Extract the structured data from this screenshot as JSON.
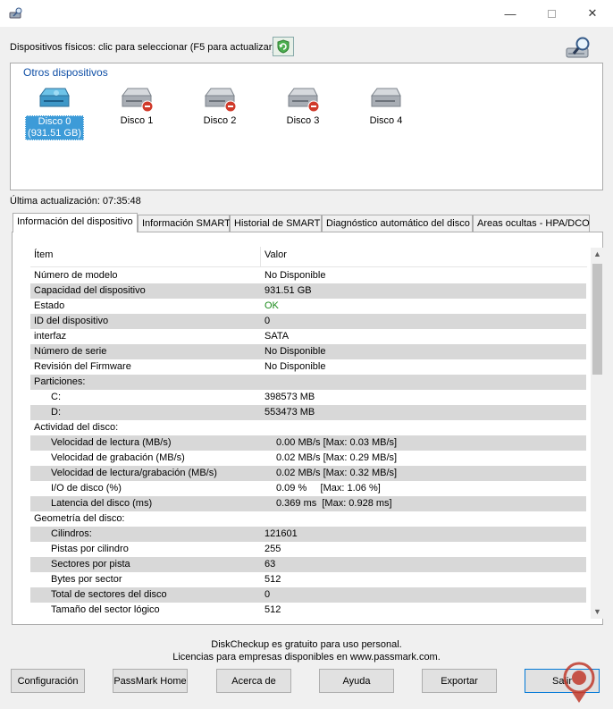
{
  "window": {
    "minimize_glyph": "—",
    "close_glyph": "✕"
  },
  "toolbar": {
    "devices_label": "Dispositivos físicos: clic para seleccionar (F5 para actualizar)"
  },
  "device_group": {
    "title": "Otros dispositivos",
    "disks": [
      {
        "name": "Disco 0",
        "size": "(931.51 GB)",
        "selected": true
      },
      {
        "name": "Disco 1",
        "size": "",
        "selected": false
      },
      {
        "name": "Disco 2",
        "size": "",
        "selected": false
      },
      {
        "name": "Disco 3",
        "size": "",
        "selected": false
      },
      {
        "name": "Disco 4",
        "size": "",
        "selected": false
      }
    ]
  },
  "last_update": "Última actualización: 07:35:48",
  "tabs": [
    {
      "label": "Información del dispositivo",
      "active": true
    },
    {
      "label": "Información SMART",
      "active": false
    },
    {
      "label": "Historial de SMART",
      "active": false
    },
    {
      "label": "Diagnóstico automático del disco",
      "active": false
    },
    {
      "label": "Areas ocultas - HPA/DCO",
      "active": false
    }
  ],
  "list": {
    "columns": [
      "Ítem",
      "Valor"
    ],
    "rows": [
      {
        "item": "Número de modelo",
        "value": "No Disponible"
      },
      {
        "item": "Capacidad del dispositivo",
        "value": "931.51 GB"
      },
      {
        "item": "Estado",
        "value": "OK"
      },
      {
        "item": "ID del dispositivo",
        "value": "0"
      },
      {
        "item": "interfaz",
        "value": "SATA"
      },
      {
        "item": "Número de serie",
        "value": "No Disponible"
      },
      {
        "item": "Revisión del Firmware",
        "value": "No Disponible"
      },
      {
        "item": "Particiones:",
        "value": ""
      },
      {
        "item": "C:",
        "value": "398573 MB"
      },
      {
        "item": "D:",
        "value": "553473 MB"
      },
      {
        "item": "Actividad del disco:",
        "value": ""
      },
      {
        "item": "Velocidad de lectura (MB/s)",
        "value": "0.00 MB/s [Max: 0.03 MB/s]"
      },
      {
        "item": "Velocidad de grabación (MB/s)",
        "value": "0.02 MB/s [Max: 0.29 MB/s]"
      },
      {
        "item": "Velocidad de lectura/grabación (MB/s)",
        "value": "0.02 MB/s [Max: 0.32 MB/s]"
      },
      {
        "item": "I/O de disco (%)",
        "value": "0.09 %     [Max: 1.06 %]"
      },
      {
        "item": "Latencia del disco (ms)",
        "value": "0.369 ms  [Max: 0.928 ms]"
      },
      {
        "item": "Geometría del disco:",
        "value": ""
      },
      {
        "item": "Cilindros:",
        "value": "121601"
      },
      {
        "item": "Pistas por cilindro",
        "value": "255"
      },
      {
        "item": "Sectores por pista",
        "value": "63"
      },
      {
        "item": "Bytes por sector",
        "value": "512"
      },
      {
        "item": "Total de sectores del disco",
        "value": "0"
      },
      {
        "item": "Tamaño del sector lógico",
        "value": "512"
      }
    ]
  },
  "footer": {
    "line1": "DiskCheckup es gratuito para uso personal.",
    "line2": "Licencias para empresas disponibles en www.passmark.com."
  },
  "buttons": {
    "config": "Configuración",
    "passmark": "PassMark Home",
    "about": "Acerca de",
    "help": "Ayuda",
    "export": "Exportar",
    "exit": "Salir"
  }
}
